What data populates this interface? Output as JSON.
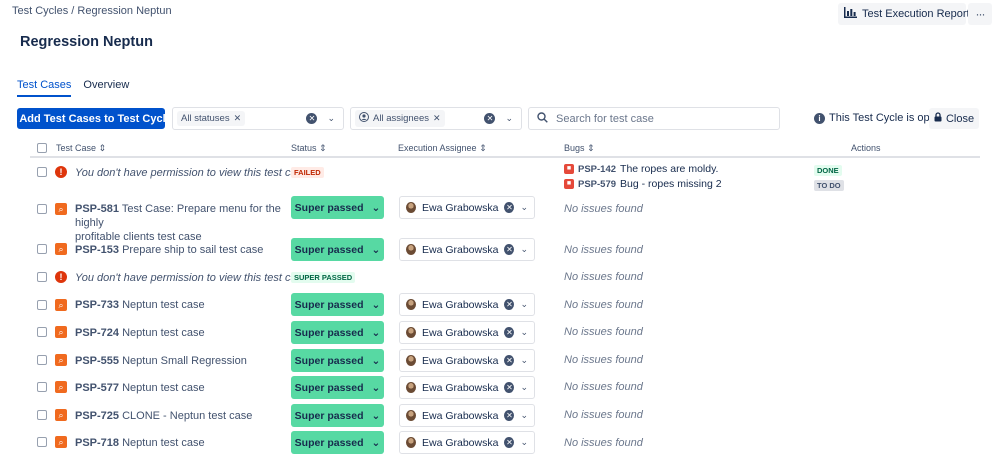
{
  "breadcrumb": "Test Cycles / Regression Neptun",
  "page_title": "Regression Neptun",
  "header_actions": {
    "report_label": "Test Execution Report",
    "more_label": "···"
  },
  "tabs": [
    {
      "label": "Test Cases"
    },
    {
      "label": "Overview"
    }
  ],
  "toolbar": {
    "add_label": "+ Add Test Cases to Test Cycle",
    "status_filter_chip": "All statuses",
    "assignee_filter_chip": "All assignees",
    "search_placeholder": "Search for test case",
    "cycle_info": "This Test Cycle is open",
    "close_label": "Close"
  },
  "columns": {
    "test_case": "Test Case",
    "status": "Status",
    "assignee": "Execution Assignee",
    "bugs": "Bugs",
    "actions": "Actions"
  },
  "rows": [
    {
      "line1": "You don't have permission to view this test case",
      "status": "FAILED",
      "bugs": [
        {
          "key": "PSP-142",
          "summary": "The ropes are moldy.",
          "state": "DONE"
        },
        {
          "key": "PSP-579",
          "summary": "Bug - ropes missing 2",
          "state": "TO DO"
        }
      ]
    },
    {
      "key": "PSP-581",
      "line1": "Test Case: Prepare menu for the highly",
      "line2": "profitable clients test case",
      "status": "Super passed",
      "assignee": "Ewa Grabowska",
      "bugs_text": "No issues found"
    },
    {
      "key": "PSP-153",
      "line1": "Prepare ship to sail test case",
      "status": "Super passed",
      "assignee": "Ewa Grabowska",
      "bugs_text": "No issues found"
    },
    {
      "line1": "You don't have permission to view this test case",
      "status": "SUPER PASSED",
      "bugs_text": "No issues found"
    },
    {
      "key": "PSP-733",
      "line1": "Neptun test case",
      "status": "Super passed",
      "assignee": "Ewa Grabowska",
      "bugs_text": "No issues found"
    },
    {
      "key": "PSP-724",
      "line1": "Neptun test case",
      "status": "Super passed",
      "assignee": "Ewa Grabowska",
      "bugs_text": "No issues found"
    },
    {
      "key": "PSP-555",
      "line1": "Neptun Small Regression",
      "status": "Super passed",
      "assignee": "Ewa Grabowska",
      "bugs_text": "No issues found"
    },
    {
      "key": "PSP-577",
      "line1": "Neptun test case",
      "status": "Super passed",
      "assignee": "Ewa Grabowska",
      "bugs_text": "No issues found"
    },
    {
      "key": "PSP-725",
      "line1": "CLONE - Neptun test case",
      "status": "Super passed",
      "assignee": "Ewa Grabowska",
      "bugs_text": "No issues found"
    },
    {
      "key": "PSP-718",
      "line1": "Neptun test case",
      "status": "Super passed",
      "assignee": "Ewa Grabowska",
      "bugs_text": "No issues found"
    }
  ],
  "colors": {
    "accent": "#0052cc",
    "super_passed": "#57d9a3",
    "failed_text": "#bf2600",
    "test_case_icon": "#f06a1f",
    "bug_icon": "#e5493a"
  },
  "icons": {
    "report": "bar-chart-icon",
    "close": "lock-icon",
    "search": "search-icon",
    "info": "info-icon",
    "test_case": "test-case-icon",
    "no_permission": "warning-icon",
    "bug": "bug-icon"
  }
}
